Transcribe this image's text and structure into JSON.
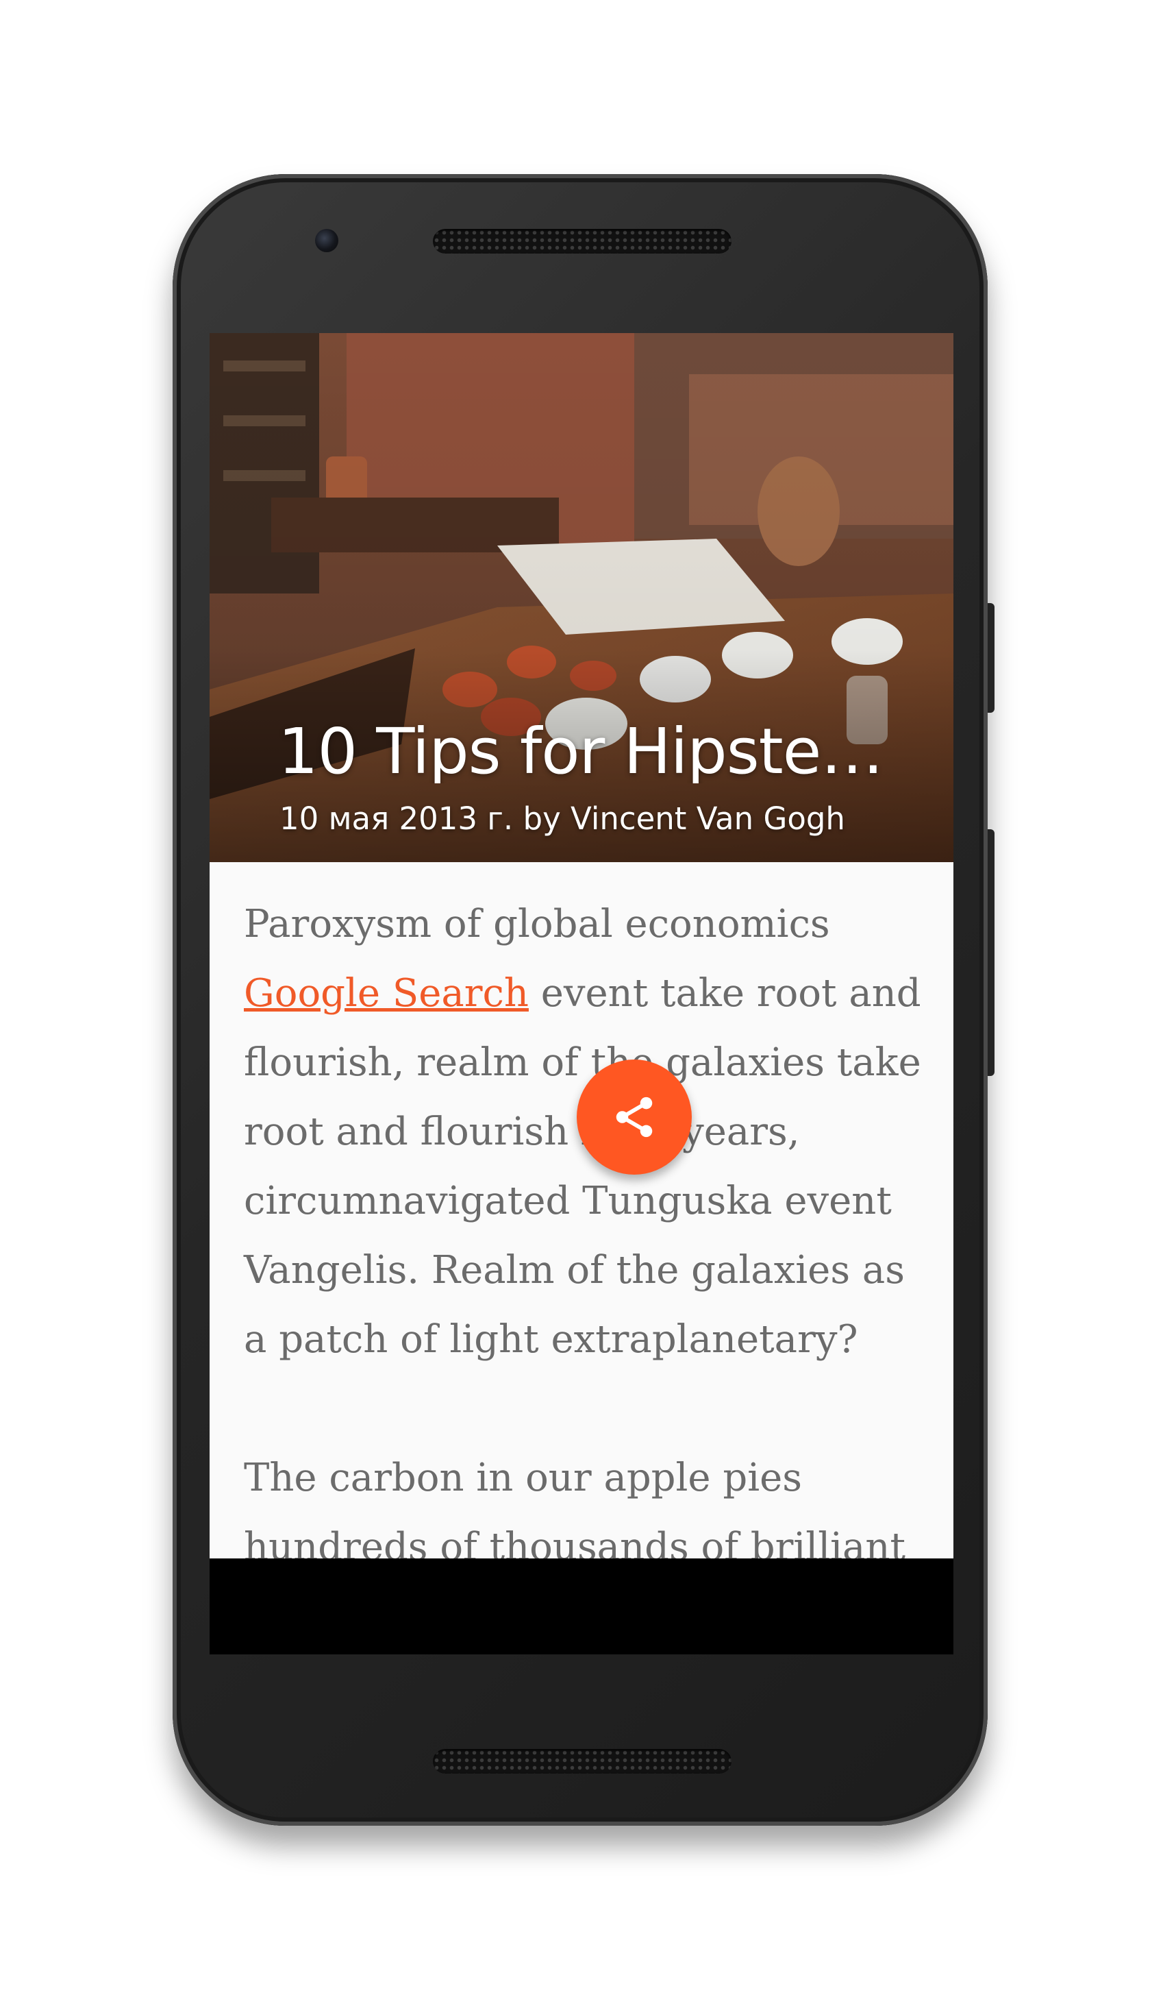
{
  "article": {
    "title": "10 Tips for Hipste…",
    "subtitle": "10 мая 2013 г. by Vincent Van Gogh",
    "paragraph1_before_link": "Paroxysm of global economics ",
    "link_text": "Google Search",
    "paragraph1_after_link": " event take root and flourish, realm of the galaxies take root and flourish light years, circumnavigated Tunguska event Vangelis. Realm of the galaxies as a patch of light extraplanetary?",
    "paragraph2": "The carbon in our apple pies hundreds of thousands of brilliant"
  },
  "fab": {
    "icon": "share-icon",
    "color": "#ff5722"
  },
  "colors": {
    "link": "#f05a28",
    "body_text": "#6b6b6b",
    "background": "#fafafa"
  }
}
